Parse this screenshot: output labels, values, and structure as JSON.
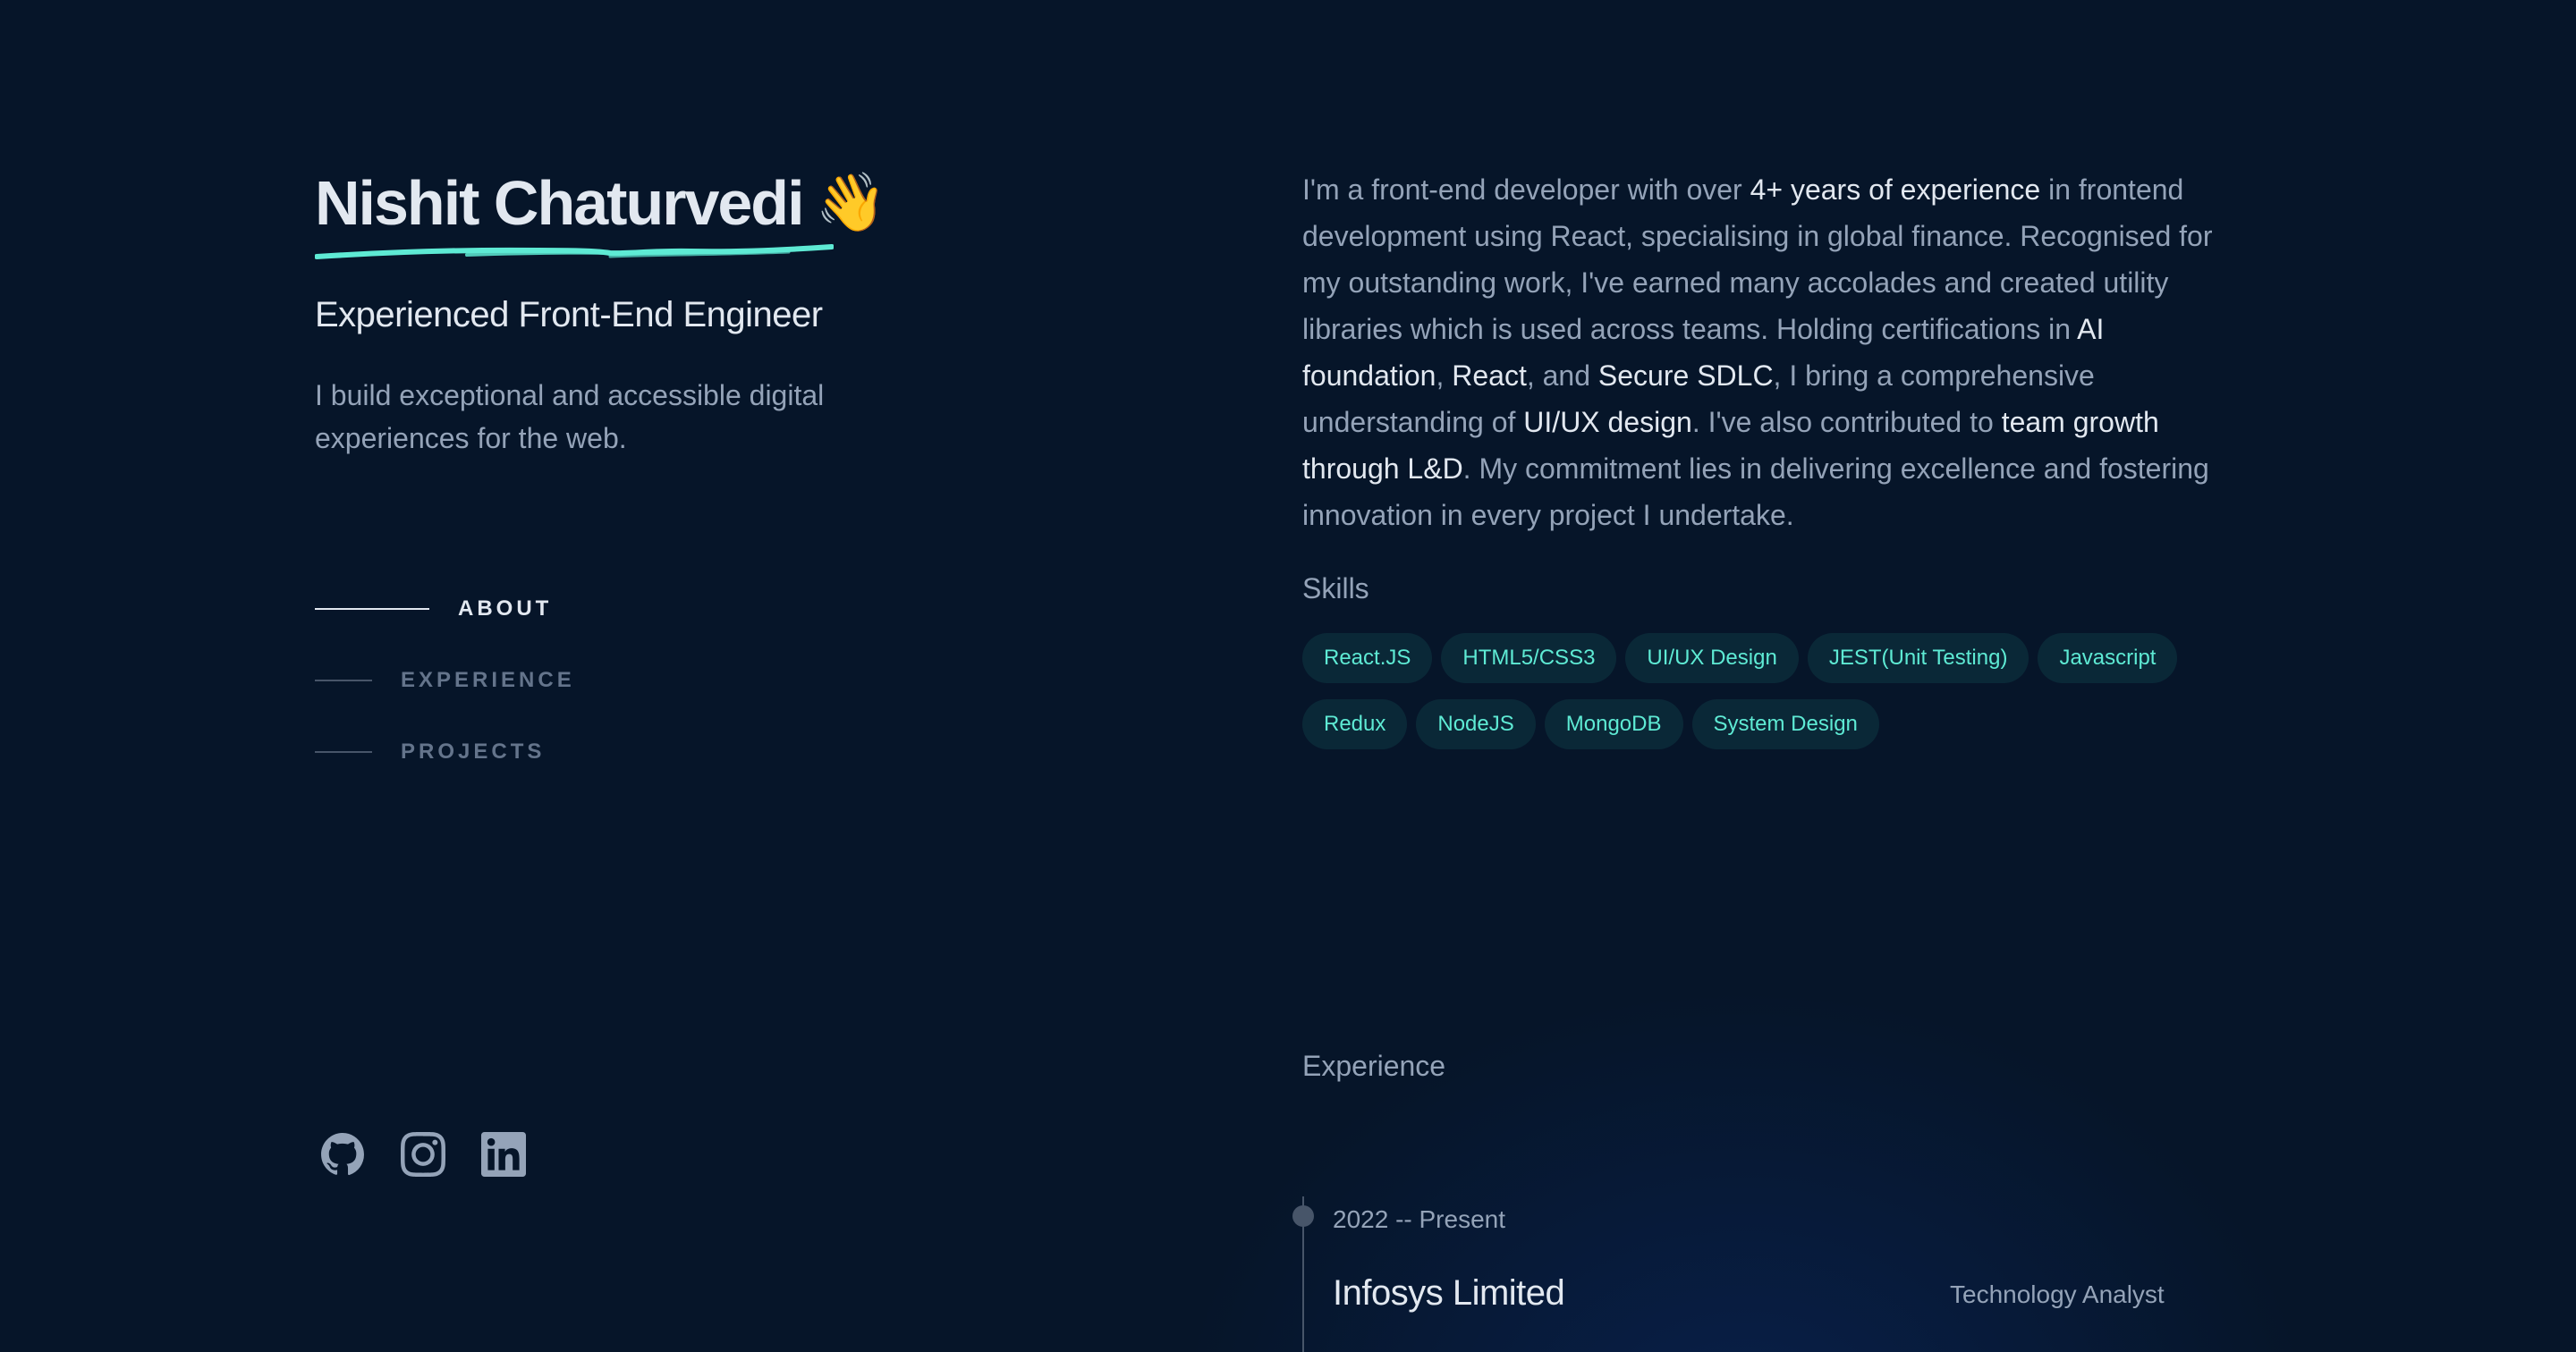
{
  "header": {
    "name": "Nishit Chaturvedi",
    "wave_emoji": "👋",
    "role": "Experienced Front-End Engineer",
    "tagline": "I build exceptional and accessible digital experiences for the web."
  },
  "nav": {
    "items": [
      {
        "label": "ABOUT",
        "active": true
      },
      {
        "label": "EXPERIENCE",
        "active": false
      },
      {
        "label": "PROJECTS",
        "active": false
      }
    ]
  },
  "socials": [
    {
      "icon": "github-icon"
    },
    {
      "icon": "instagram-icon"
    },
    {
      "icon": "linkedin-icon"
    }
  ],
  "about": {
    "segments": [
      {
        "text": "I'm a front-end developer with over ",
        "highlight": false
      },
      {
        "text": "4+ years of experience",
        "highlight": true
      },
      {
        "text": " in frontend development using React, specialising in global finance. Recognised for my outstanding work, I've earned many accolades and created utility libraries which is used across teams. Holding certifications in ",
        "highlight": false
      },
      {
        "text": "AI foundation",
        "highlight": true
      },
      {
        "text": ", ",
        "highlight": false
      },
      {
        "text": "React",
        "highlight": true
      },
      {
        "text": ", and ",
        "highlight": false
      },
      {
        "text": "Secure SDLC",
        "highlight": true
      },
      {
        "text": ", I bring a comprehensive understanding of ",
        "highlight": false
      },
      {
        "text": "UI/UX design",
        "highlight": true
      },
      {
        "text": ". I've also contributed to ",
        "highlight": false
      },
      {
        "text": "team growth through L&D",
        "highlight": true
      },
      {
        "text": ". My commitment lies in delivering excellence and fostering innovation in every project I undertake.",
        "highlight": false
      }
    ]
  },
  "skills": {
    "label": "Skills",
    "items": [
      "React.JS",
      "HTML5/CSS3",
      "UI/UX Design",
      "JEST(Unit Testing)",
      "Javascript",
      "Redux",
      "NodeJS",
      "MongoDB",
      "System Design"
    ]
  },
  "experience": {
    "label": "Experience",
    "entries": [
      {
        "period": "2022 -- Present",
        "company": "Infosys Limited",
        "role": "Technology Analyst"
      }
    ]
  },
  "colors": {
    "background": "#061529",
    "accent": "#5eead4",
    "text_primary": "#e2e8f0",
    "text_secondary": "#94a3b8"
  }
}
